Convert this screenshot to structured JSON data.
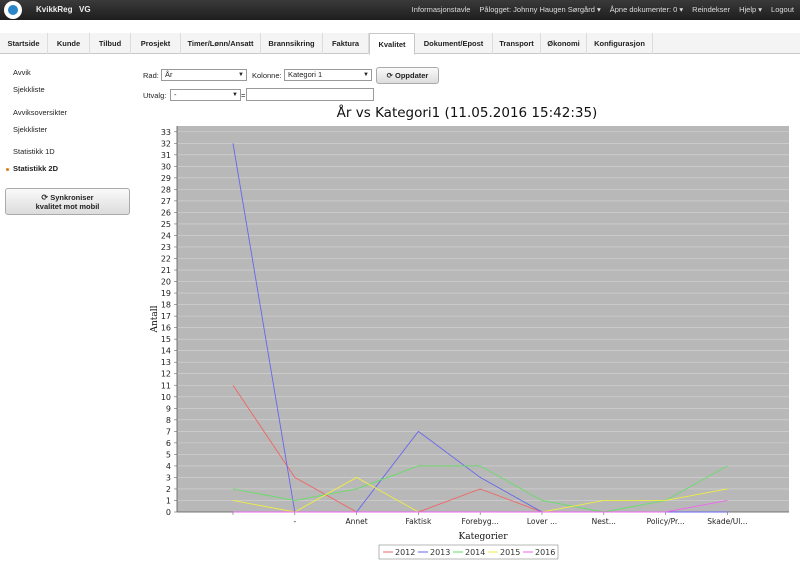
{
  "app": {
    "brand": "KvikkReg",
    "brand_sub": "VG"
  },
  "topmenu": [
    "Informasjonstavle",
    "Pålogget: Johnny Haugen Sørgård ▾",
    "Åpne dokumenter: 0 ▾",
    "Reindekser",
    "Hjelp ▾",
    "Logout"
  ],
  "tabs": [
    {
      "label": "Startside"
    },
    {
      "label": "Kunde"
    },
    {
      "label": "Tilbud"
    },
    {
      "label": "Prosjekt"
    },
    {
      "label": "Timer/Lønn/Ansatt"
    },
    {
      "label": "Brannsikring"
    },
    {
      "label": "Faktura"
    },
    {
      "label": "Kvalitet",
      "active": true
    },
    {
      "label": "Dokument/Epost"
    },
    {
      "label": "Transport"
    },
    {
      "label": "Økonomi"
    },
    {
      "label": "Konfigurasjon"
    }
  ],
  "sidebar": [
    {
      "label": "Avvik"
    },
    {
      "label": "Sjekkliste"
    },
    {
      "label": "Avviksoversikter"
    },
    {
      "label": "Sjekklister"
    },
    {
      "label": "Statistikk 1D"
    },
    {
      "label": "Statistikk 2D",
      "active": true
    }
  ],
  "sync_button": {
    "line1": "Synkroniser",
    "line2": "kvalitet mot mobil",
    "icon": "sync-icon"
  },
  "filters": {
    "rad_label": "Rad:",
    "rad_value": "År",
    "kolonne_label": "Kolonne:",
    "kolonne_value": "Kategori 1",
    "update_label": "Oppdater",
    "utvalg_label": "Utvalg:",
    "utvalg_value": "-",
    "eq": "="
  },
  "chart_data": {
    "type": "line",
    "title": "År vs Kategori1 (11.05.2016 15:42:35)",
    "xlabel": "Kategorier",
    "ylabel": "Antall",
    "ylim": [
      0,
      33
    ],
    "categories": [
      "",
      "-",
      "Annet",
      "Faktisk",
      "Forebyg...",
      "Lover ...",
      "Nest...",
      "Policy/Pr...",
      "Skade/Ul..."
    ],
    "series": [
      {
        "name": "2012",
        "color": "#ee6666",
        "values": [
          11,
          3,
          0,
          0,
          2,
          0,
          0,
          0,
          0
        ]
      },
      {
        "name": "2013",
        "color": "#6666ee",
        "values": [
          32,
          0,
          0,
          7,
          3,
          0,
          0,
          0,
          0
        ]
      },
      {
        "name": "2014",
        "color": "#66dd66",
        "values": [
          2,
          1,
          2,
          4,
          4,
          1,
          0,
          1,
          4
        ]
      },
      {
        "name": "2015",
        "color": "#eeee44",
        "values": [
          1,
          0,
          3,
          0,
          0,
          0,
          1,
          1,
          2
        ]
      },
      {
        "name": "2016",
        "color": "#ee66ee",
        "values": [
          0,
          0,
          0,
          0,
          0,
          0,
          0,
          0,
          1
        ]
      }
    ],
    "background": "#b8b8b8",
    "grid": true,
    "legend_position": "bottom"
  }
}
